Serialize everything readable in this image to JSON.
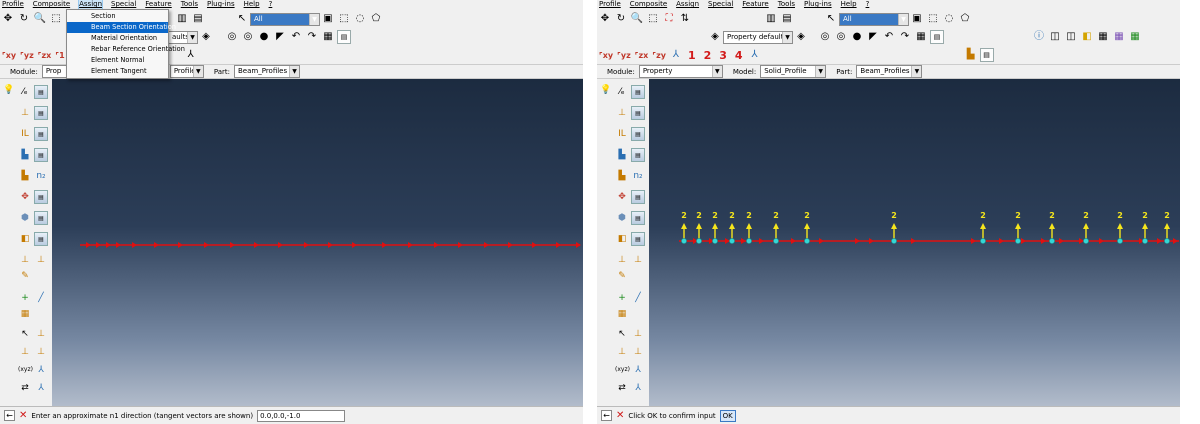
{
  "menu": [
    "Profile",
    "Composite",
    "Assign",
    "Special",
    "Feature",
    "Tools",
    "Plug-ins",
    "Help",
    "?"
  ],
  "left": {
    "assign_menu": [
      "Section",
      "Beam Section Orientation",
      "Material Orientation",
      "Rebar Reference Orientation",
      "Element Normal",
      "Element Tangent"
    ],
    "highlighted_item": "Beam Section Orientation",
    "select_combo": "All",
    "defaults_combo": "aults",
    "module_label": "Module:",
    "module_value": "Prop",
    "model_value": "Profile",
    "part_label": "Part:",
    "part_value": "Beam_Profiles",
    "prompt_text": "Enter an approximate n1 direction (tangent vectors are shown)",
    "prompt_value": "0.0,0.0,-1.0"
  },
  "right": {
    "select_combo": "All",
    "defaults_combo": "Property defaults",
    "number_tools": [
      "1",
      "2",
      "3",
      "4"
    ],
    "module_label": "Module:",
    "module_value": "Property",
    "model_label": "Model:",
    "model_value": "Solid_Profile",
    "part_label": "Part:",
    "part_value": "Beam_Profiles",
    "prompt_text": "Click OK to confirm input",
    "ok_label": "OK",
    "node_label": "2"
  },
  "colors": {
    "viewport_top": "#1c2b40",
    "viewport_bottom": "#b2bccb",
    "beam_red": "#e01010",
    "node_cyan": "#34d6d6",
    "n2_yellow": "#f6e61c",
    "menu_highlight": "#0a67c9"
  },
  "icons": [
    "back-arrow-icon",
    "cancel-x-icon",
    "lightbulb-icon",
    "assign-section-icon",
    "beam-orientation-icon",
    "triad-icon"
  ]
}
